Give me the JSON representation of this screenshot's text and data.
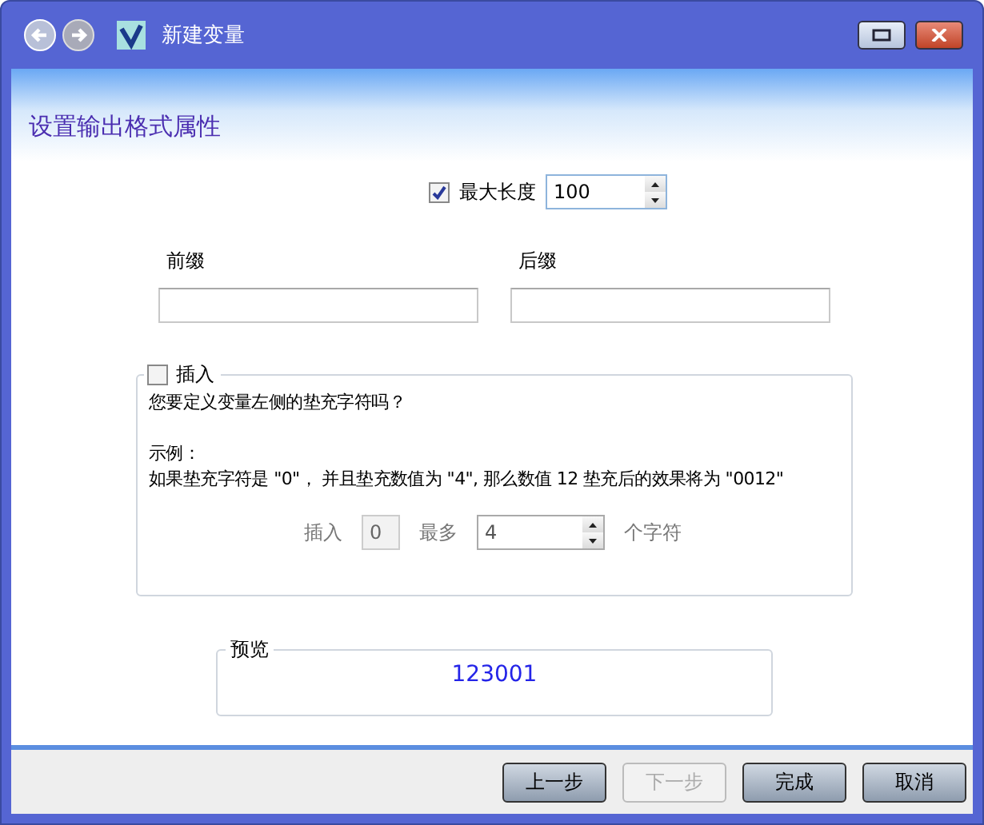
{
  "window": {
    "title": "新建变量"
  },
  "heading": "设置输出格式属性",
  "max_length": {
    "label": "最大长度",
    "checked": true,
    "value": "100"
  },
  "prefix": {
    "label": "前缀"
  },
  "suffix": {
    "label": "后缀"
  },
  "padding": {
    "label": "插入",
    "checked": false,
    "question": "您要定义变量左侧的垫充字符吗？",
    "example_title": "示例：",
    "example_text": "如果垫充字符是 \"0\"， 并且垫充数值为 \"4\", 那么数值 12 垫充后的效果将为 \"0012\"",
    "insert_label": "插入",
    "insert_value": "0",
    "max_label": "最多",
    "max_value": "4",
    "unit_label": "个字符"
  },
  "preview": {
    "label": "预览",
    "value": "123001"
  },
  "buttons": [
    {
      "label": "上一步",
      "disabled": false
    },
    {
      "label": "下一步",
      "disabled": true
    },
    {
      "label": "完成",
      "disabled": false
    },
    {
      "label": "取消",
      "disabled": false
    }
  ]
}
